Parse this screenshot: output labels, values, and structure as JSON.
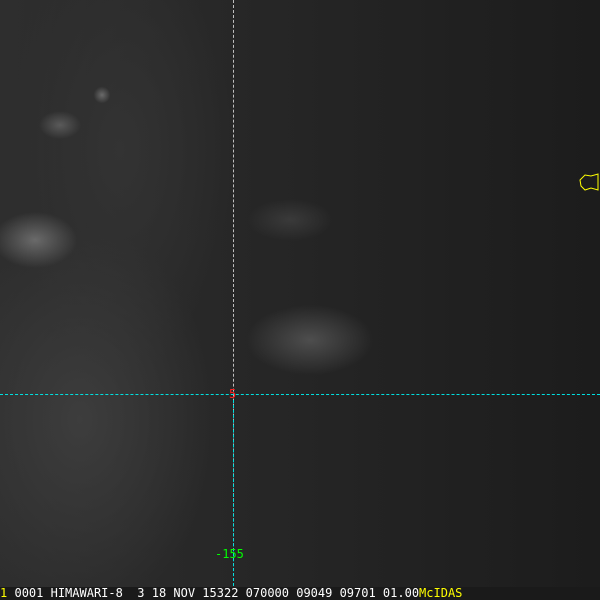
{
  "overlay": {
    "latitude_label": "5",
    "longitude_label": "-155"
  },
  "status_bar": {
    "frame": "1",
    "info": "0001 HIMAWARI-8  3 18 NOV 15322 070000 09049 09701 01.00",
    "brand": "McIDAS"
  },
  "colors": {
    "grid": "#00e0e0",
    "lat": "#ff2020",
    "lon": "#00ff00",
    "brand": "#ffff00"
  }
}
